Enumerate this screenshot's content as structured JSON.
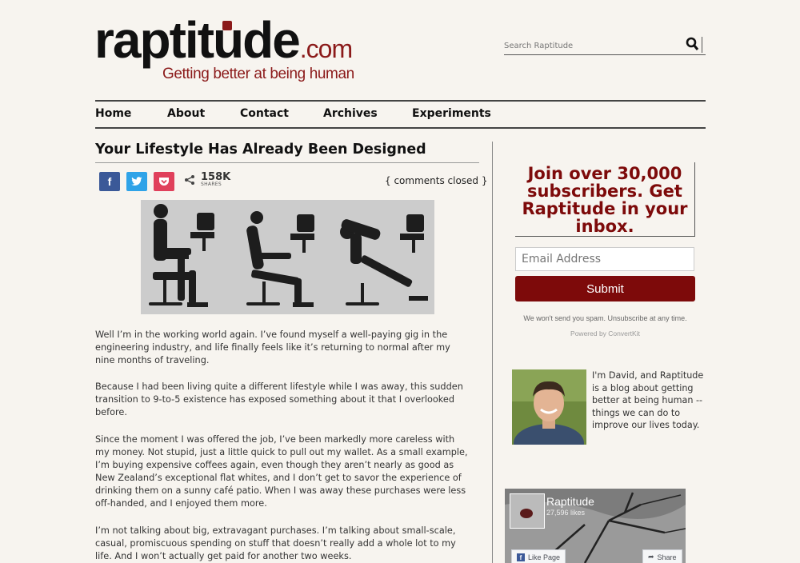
{
  "site": {
    "logo_main": "raptitude",
    "logo_tld": ".com",
    "tagline": "Getting better at being human",
    "search_placeholder": "Search Raptitude"
  },
  "nav": {
    "items": [
      "Home",
      "About",
      "Contact",
      "Archives",
      "Experiments"
    ]
  },
  "post": {
    "title": "Your Lifestyle Has Already Been Designed",
    "share_count": "158K",
    "share_label": "SHARES",
    "comments_status": "{ comments closed }",
    "paragraphs": [
      "Well I’m in the working world again. I’ve found myself a well-paying gig in the engineering industry, and life finally feels like it’s returning to normal after my nine months of traveling.",
      "Because I had been living quite a different lifestyle while I was away, this sudden transition to 9-to-5 existence has exposed something about it that I overlooked before.",
      "Since the moment I was offered the job, I’ve been markedly more careless with my money. Not stupid, just a little quick to pull out my wallet. As a small example, I’m buying expensive coffees again, even though they aren’t nearly as good as New Zealand’s exceptional flat whites, and I don’t get to savor the experience of drinking them on a sunny café patio. When I was away these purchases were less off-handed, and I enjoyed them more.",
      "I’m not talking about big, extravagant purchases. I’m talking about small-scale, casual, promiscuous spending on stuff that doesn’t really add a whole lot to my life. And I won’t actually get paid for another two weeks."
    ]
  },
  "sidebar": {
    "signup_heading": "Join over 30,000 subscribers. Get Raptitude in your inbox.",
    "email_placeholder": "Email Address",
    "submit_label": "Submit",
    "no_spam": "We won't send you spam. Unsubscribe at any time.",
    "powered_by": "Powered by ConvertKit",
    "about_text": "I'm David, and Raptitude is a blog about getting better at being human -- things we can do to improve our lives today.",
    "fb_page_name": "Raptitude",
    "fb_likes": "27,596 likes",
    "fb_like_label": "Like Page",
    "fb_share_label": "Share"
  },
  "colors": {
    "accent": "#7d0a0a",
    "background": "#f7f4ef"
  },
  "icons": [
    "search-icon",
    "facebook-icon",
    "twitter-icon",
    "pocket-icon",
    "share-icon"
  ]
}
